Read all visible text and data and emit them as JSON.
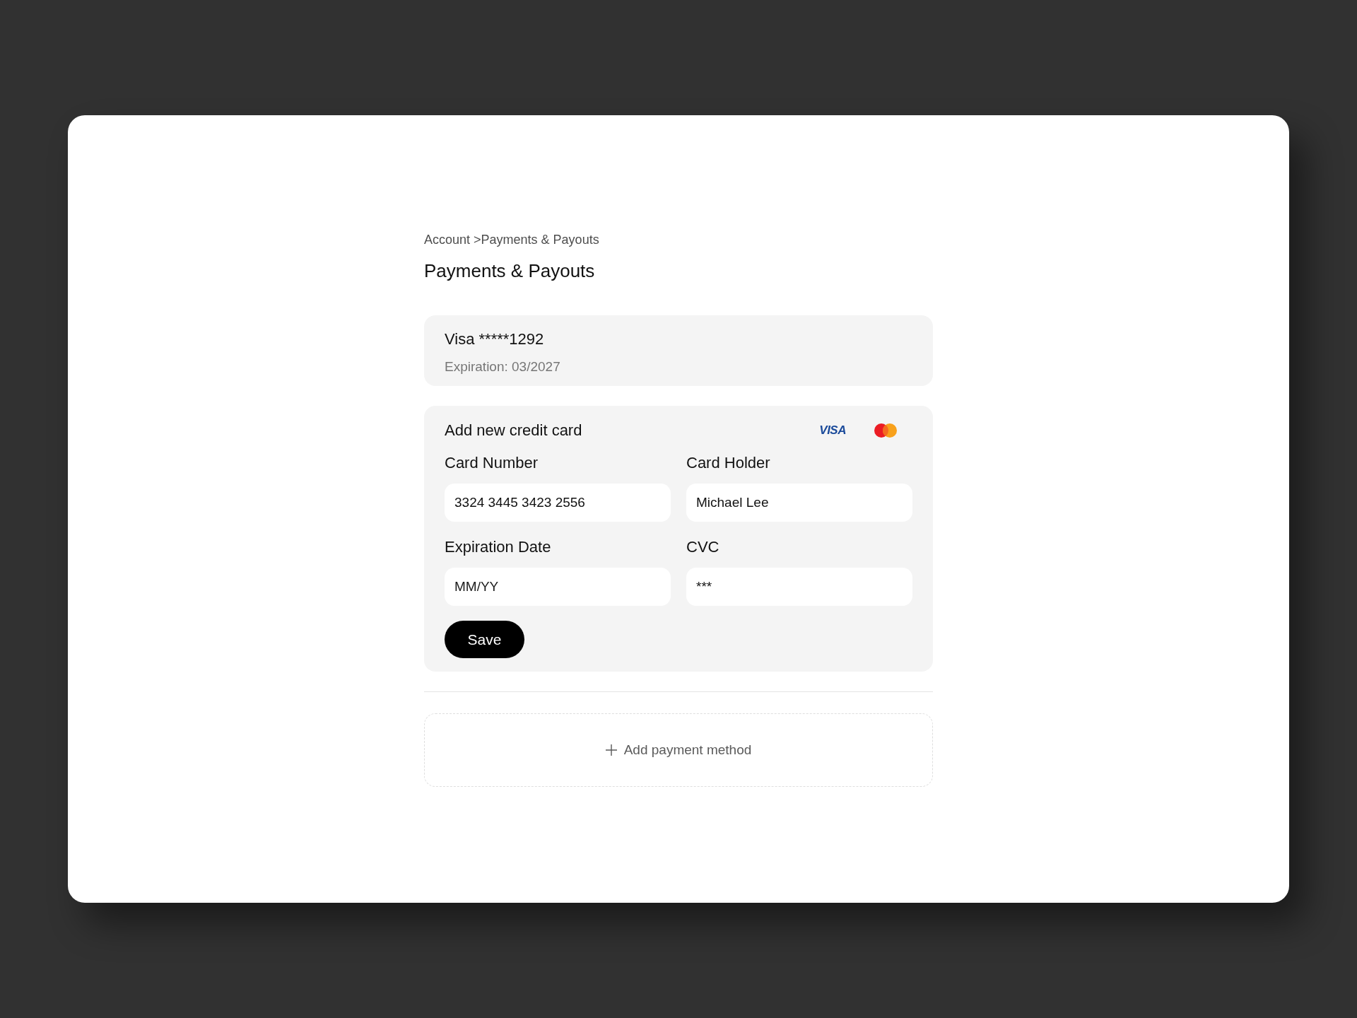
{
  "breadcrumb": {
    "items": [
      "Account",
      "Payments & Payouts"
    ],
    "separator": ">"
  },
  "title": "Payments & Payouts",
  "saved_cards": [
    {
      "name": "Visa *****1292",
      "expiration": "Expiration: 03/2027"
    }
  ],
  "new_card_form": {
    "title": "Add new credit card",
    "brands": [
      {
        "kind": "wordmark",
        "label": "VISA"
      },
      {
        "kind": "circles"
      }
    ],
    "fields": [
      {
        "label": "Card Number",
        "value": "3324 3445 3423 2556"
      },
      {
        "label": "Card Holder",
        "value": "Michael Lee"
      },
      {
        "label": "Expiration Date",
        "placeholder": "MM/YY"
      },
      {
        "label": "CVC",
        "value": "***"
      }
    ],
    "save_button": "Save"
  },
  "add_payment_method": {
    "label": "Add payment method"
  }
}
